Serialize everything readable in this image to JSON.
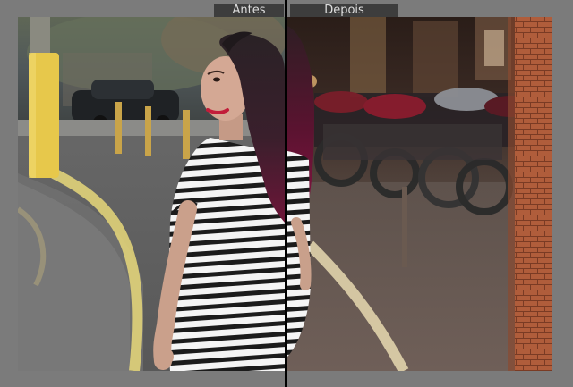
{
  "labels": {
    "before": "Antes",
    "after": "Depois"
  },
  "colors": {
    "frame": "#7b7b7b",
    "label_bg": "#3d3d3d",
    "label_text": "#dedede",
    "divider": "#000000"
  }
}
